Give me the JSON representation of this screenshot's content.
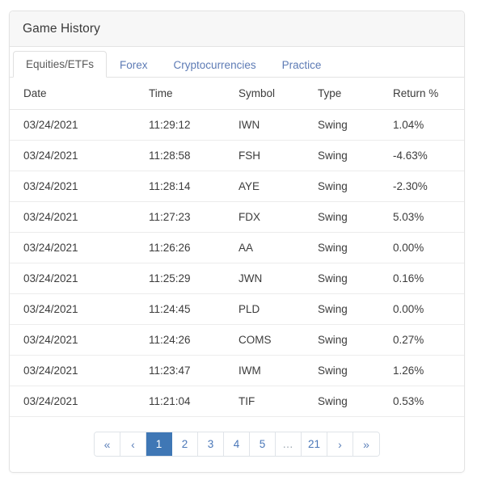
{
  "card": {
    "title": "Game History"
  },
  "tabs": [
    {
      "label": "Equities/ETFs",
      "active": true
    },
    {
      "label": "Forex",
      "active": false
    },
    {
      "label": "Cryptocurrencies",
      "active": false
    },
    {
      "label": "Practice",
      "active": false
    }
  ],
  "table": {
    "columns": [
      "Date",
      "Time",
      "Symbol",
      "Type",
      "Return %"
    ],
    "rows": [
      {
        "date": "03/24/2021",
        "time": "11:29:12",
        "symbol": "IWN",
        "type": "Swing",
        "return": "1.04%",
        "sign": "pos"
      },
      {
        "date": "03/24/2021",
        "time": "11:28:58",
        "symbol": "FSH",
        "type": "Swing",
        "return": "-4.63%",
        "sign": "neg"
      },
      {
        "date": "03/24/2021",
        "time": "11:28:14",
        "symbol": "AYE",
        "type": "Swing",
        "return": "-2.30%",
        "sign": "neg"
      },
      {
        "date": "03/24/2021",
        "time": "11:27:23",
        "symbol": "FDX",
        "type": "Swing",
        "return": "5.03%",
        "sign": "pos"
      },
      {
        "date": "03/24/2021",
        "time": "11:26:26",
        "symbol": "AA",
        "type": "Swing",
        "return": "0.00%",
        "sign": "pos"
      },
      {
        "date": "03/24/2021",
        "time": "11:25:29",
        "symbol": "JWN",
        "type": "Swing",
        "return": "0.16%",
        "sign": "pos"
      },
      {
        "date": "03/24/2021",
        "time": "11:24:45",
        "symbol": "PLD",
        "type": "Swing",
        "return": "0.00%",
        "sign": "pos"
      },
      {
        "date": "03/24/2021",
        "time": "11:24:26",
        "symbol": "COMS",
        "type": "Swing",
        "return": "0.27%",
        "sign": "pos"
      },
      {
        "date": "03/24/2021",
        "time": "11:23:47",
        "symbol": "IWM",
        "type": "Swing",
        "return": "1.26%",
        "sign": "pos"
      },
      {
        "date": "03/24/2021",
        "time": "11:21:04",
        "symbol": "TIF",
        "type": "Swing",
        "return": "0.53%",
        "sign": "pos"
      }
    ]
  },
  "pagination": {
    "items": [
      {
        "label": "«",
        "name": "first-page-button",
        "kind": "chev",
        "active": false
      },
      {
        "label": "‹",
        "name": "previous-page-button",
        "kind": "chev",
        "active": false
      },
      {
        "label": "1",
        "name": "page-button-1",
        "kind": "page",
        "active": true
      },
      {
        "label": "2",
        "name": "page-button-2",
        "kind": "page",
        "active": false
      },
      {
        "label": "3",
        "name": "page-button-3",
        "kind": "page",
        "active": false
      },
      {
        "label": "4",
        "name": "page-button-4",
        "kind": "page",
        "active": false
      },
      {
        "label": "5",
        "name": "page-button-5",
        "kind": "page",
        "active": false
      },
      {
        "label": "…",
        "name": "page-ellipsis",
        "kind": "ellipsis",
        "active": false
      },
      {
        "label": "21",
        "name": "page-button-21",
        "kind": "page",
        "active": false
      },
      {
        "label": "›",
        "name": "next-page-button",
        "kind": "chev",
        "active": false
      },
      {
        "label": "»",
        "name": "last-page-button",
        "kind": "chev",
        "active": false
      }
    ]
  },
  "colors": {
    "accent": "#3f77b5",
    "link": "#4a77b8",
    "positive": "#28903e",
    "negative": "#e8453c",
    "header_bg": "#f7f7f7",
    "border": "#e3e3e3"
  }
}
